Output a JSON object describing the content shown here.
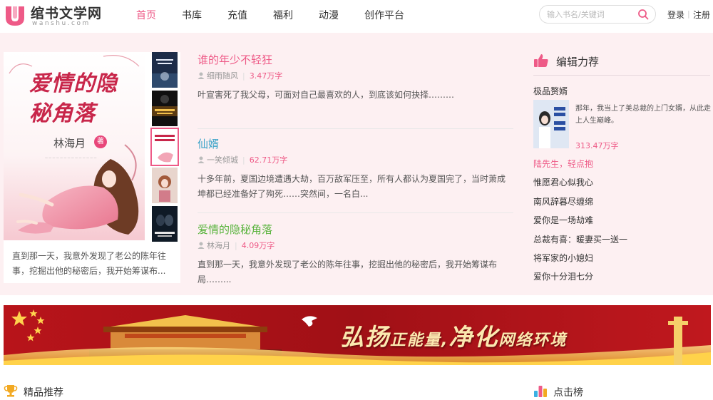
{
  "header": {
    "logo_name": "绾书文学网",
    "logo_domain": "wanshu.com",
    "nav": [
      "首页",
      "书库",
      "充值",
      "福利",
      "动漫",
      "创作平台"
    ],
    "search_placeholder": "输入书名/关键词",
    "login": "登录",
    "register": "注册",
    "accent_color": "#ee5a87"
  },
  "featured": {
    "cover_title": "爱情的隐秘角落",
    "cover_author": "林海月",
    "cover_tag": "著",
    "description": "直到那一天，我意外发现了老公的陈年往事，挖掘出他的秘密后，我开始筹谋布..."
  },
  "books": [
    {
      "title": "谁的年少不轻狂",
      "author": "细雨随风",
      "count": "3.47万字",
      "title_color": "#ee5a87",
      "desc": "叶宣害死了我父母，可面对自己最喜欢的人，到底该如何抉择………"
    },
    {
      "title": "仙婿",
      "author": "一笑倾城",
      "count": "62.71万字",
      "title_color": "#3aa2c8",
      "desc": "十多年前，夏国边境遭遇大劫，百万敌军压至，所有人都认为夏国完了，当时萧成坤都已经准备好了殉死……突然间，一名白..."
    },
    {
      "title": "爱情的隐秘角落",
      "author": "林海月",
      "count": "4.09万字",
      "title_color": "#58b33c",
      "desc": "直到那一天，我意外发现了老公的陈年往事，挖掘出他的秘密后，我开始筹谋布局……..."
    }
  ],
  "editor": {
    "heading": "编辑力荐",
    "top_title": "极品赘婿",
    "top_desc": "那年，我当上了美总裁的上门女婿，从此走上人生巅峰。",
    "top_count": "313.47万字",
    "list": [
      "陆先生，轻点抱",
      "惟愿君心似我心",
      "南风辞暮尽缠绵",
      "爱你是一场劫难",
      "总裁有喜：暖妻买一送一",
      "将军家的小媳妇",
      "爱你十分泪七分"
    ]
  },
  "banner": {
    "text_a": "弘扬",
    "text_b": "正能量,",
    "text_c": "净化",
    "text_d": "网络环境"
  },
  "sections": {
    "left": "精品推荐",
    "right": "点击榜"
  }
}
